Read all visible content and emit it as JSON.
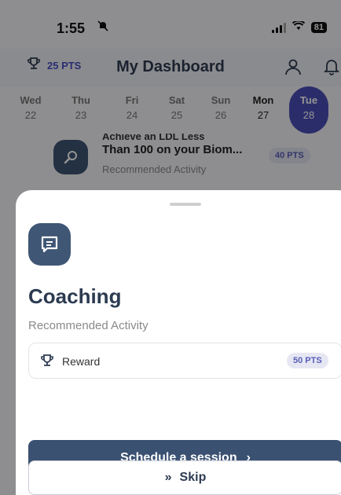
{
  "status_bar": {
    "time": "1:55",
    "battery": "81"
  },
  "header": {
    "points": "25 PTS",
    "title": "My Dashboard"
  },
  "week": [
    {
      "name": "Wed",
      "date": "22"
    },
    {
      "name": "Thu",
      "date": "23"
    },
    {
      "name": "Fri",
      "date": "24"
    },
    {
      "name": "Sat",
      "date": "25"
    },
    {
      "name": "Sun",
      "date": "26"
    },
    {
      "name": "Mon",
      "date": "27"
    },
    {
      "name": "Tue",
      "date": "28"
    }
  ],
  "activity": {
    "top_fragment": "Achieve an LDL Less",
    "title": "Than 100 on your Biom...",
    "subtitle": "Recommended Activity",
    "points": "40 PTS"
  },
  "sheet": {
    "title": "Coaching",
    "subtitle": "Recommended Activity",
    "reward_label": "Reward",
    "reward_points": "50 PTS",
    "primary_label": "Schedule a session",
    "primary_chevron": "›",
    "secondary_label": "Skip",
    "secondary_chevron": "»"
  },
  "icons": [
    "bell-off-icon",
    "signal-icon",
    "wifi-icon",
    "battery-icon",
    "trophy-icon",
    "profile-icon",
    "bell-icon",
    "search-icon",
    "chat-icon"
  ],
  "colors": {
    "accent": "#4b4fb8",
    "primary_button": "#3b5172",
    "icon_bg": "#3f5675"
  }
}
